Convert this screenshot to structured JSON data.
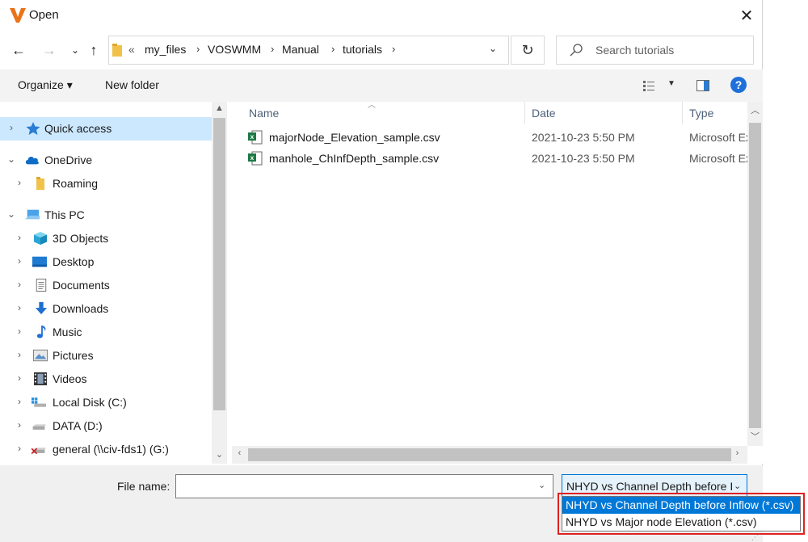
{
  "window": {
    "title": "Open"
  },
  "nav": {
    "back_icon": "back-arrow-icon",
    "forward_icon": "forward-arrow-icon",
    "recent_icon": "chevron-down-icon",
    "up_icon": "up-arrow-icon"
  },
  "address": {
    "overflow": "«",
    "segments": [
      "my_files",
      "VOSWMM",
      "Manual",
      "tutorials"
    ]
  },
  "search": {
    "placeholder": "Search tutorials"
  },
  "toolbar": {
    "organize_label": "Organize ▾",
    "new_folder_label": "New folder"
  },
  "sidebar": {
    "items": [
      {
        "label": "Quick access",
        "icon": "star-icon",
        "expand": "›",
        "selected": true
      },
      {
        "label": "OneDrive",
        "icon": "cloud-icon",
        "expand": "⌄"
      },
      {
        "label": "Roaming",
        "icon": "folder-icon",
        "expand": "›"
      },
      {
        "label": "This PC",
        "icon": "computer-icon",
        "expand": "⌄"
      },
      {
        "label": "3D Objects",
        "icon": "cube-icon",
        "expand": "›"
      },
      {
        "label": "Desktop",
        "icon": "desktop-icon",
        "expand": "›"
      },
      {
        "label": "Documents",
        "icon": "document-icon",
        "expand": "›"
      },
      {
        "label": "Downloads",
        "icon": "download-icon",
        "expand": "›"
      },
      {
        "label": "Music",
        "icon": "music-icon",
        "expand": "›"
      },
      {
        "label": "Pictures",
        "icon": "pictures-icon",
        "expand": "›"
      },
      {
        "label": "Videos",
        "icon": "video-icon",
        "expand": "›"
      },
      {
        "label": "Local Disk (C:)",
        "icon": "windows-drive-icon",
        "expand": "›"
      },
      {
        "label": "DATA (D:)",
        "icon": "drive-icon",
        "expand": "›"
      },
      {
        "label": "general (\\\\civ-fds1) (G:)",
        "icon": "network-drive-disconnected-icon",
        "expand": "›"
      }
    ]
  },
  "files": {
    "columns": [
      "Name",
      "Date",
      "Type"
    ],
    "rows": [
      {
        "name": "majorNode_Elevation_sample.csv",
        "date": "2021-10-23 5:50 PM",
        "type": "Microsoft Excel"
      },
      {
        "name": "manhole_ChInfDepth_sample.csv",
        "date": "2021-10-23 5:50 PM",
        "type": "Microsoft Excel"
      }
    ]
  },
  "bottom": {
    "file_name_label": "File name:",
    "file_name_value": "",
    "filter_selected": "NHYD vs Channel Depth before Inflow (*.csv)"
  },
  "filter_options": [
    "NHYD vs Channel Depth before Inflow (*.csv)",
    "NHYD vs Major node Elevation (*.csv)"
  ],
  "colors": {
    "selection": "#cce8ff",
    "accent": "#0078d7",
    "highlight": "#e02020",
    "toolbar_bg": "#f3f3f3"
  }
}
